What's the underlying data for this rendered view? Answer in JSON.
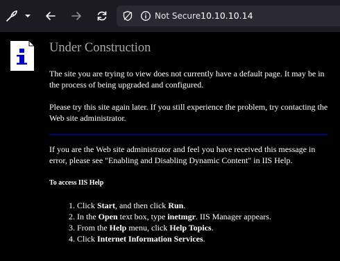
{
  "browser": {
    "security_label": "Not Secure",
    "url": "10.10.10.14",
    "icons": [
      "extension-icon",
      "dropdown-icon",
      "back-icon",
      "forward-icon",
      "reload-icon",
      "tracking-shield-icon",
      "info-icon"
    ]
  },
  "page": {
    "title": "Under Construction",
    "paragraph1": "The site you are trying to view does not currently have a default page. It may be in the process of being upgraded and configured.",
    "paragraph2": "Please try this site again later. If you still experience the problem, try contacting the Web site administrator.",
    "paragraph3": "If you are the Web site administrator and feel you have received this message in error, please see \"Enabling and Disabling Dynamic Content\" in IIS Help.",
    "subheading": "To access IIS Help",
    "steps": [
      {
        "pre": "1. Click ",
        "b1": "Start",
        "mid": ", and then click ",
        "b2": "Run",
        "post": "."
      },
      {
        "pre": "2. In the ",
        "b1": "Open",
        "mid": " text box, type ",
        "b2": "inetmgr",
        "post": ". IIS Manager appears."
      },
      {
        "pre": "3. From the ",
        "b1": "Help",
        "mid": " menu, click ",
        "b2": "Help Topics",
        "post": "."
      },
      {
        "pre": "4. Click ",
        "b1": "Internet Information Services",
        "mid": "",
        "b2": "",
        "post": "."
      }
    ],
    "colors": {
      "background": "#000000",
      "title": "#a9a9a9",
      "text": "#ffffff",
      "rule": "#000080",
      "logo_i": "#0000cc"
    }
  }
}
